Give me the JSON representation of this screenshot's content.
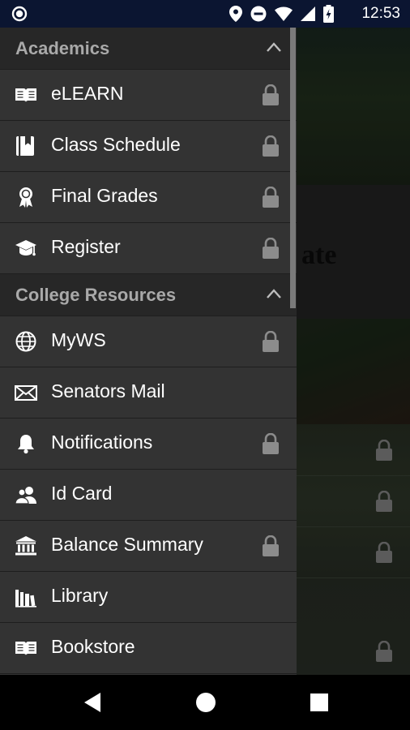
{
  "status_bar": {
    "time": "12:53"
  },
  "background": {
    "heading_fragment": "ate"
  },
  "drawer": {
    "sections": [
      {
        "title": "Academics",
        "items": [
          {
            "label": "eLEARN",
            "icon": "open-book-icon",
            "locked": true
          },
          {
            "label": "Class Schedule",
            "icon": "bookmark-book-icon",
            "locked": true
          },
          {
            "label": "Final Grades",
            "icon": "award-ribbon-icon",
            "locked": true
          },
          {
            "label": "Register",
            "icon": "graduation-cap-icon",
            "locked": true
          }
        ]
      },
      {
        "title": "College Resources",
        "items": [
          {
            "label": "MyWS",
            "icon": "globe-icon",
            "locked": true
          },
          {
            "label": "Senators Mail",
            "icon": "envelope-icon",
            "locked": false
          },
          {
            "label": "Notifications",
            "icon": "bell-icon",
            "locked": true
          },
          {
            "label": "Id Card",
            "icon": "users-icon",
            "locked": false
          },
          {
            "label": "Balance Summary",
            "icon": "bank-icon",
            "locked": true
          },
          {
            "label": "Library",
            "icon": "library-books-icon",
            "locked": false
          },
          {
            "label": "Bookstore",
            "icon": "open-book-icon",
            "locked": false
          }
        ]
      }
    ]
  }
}
